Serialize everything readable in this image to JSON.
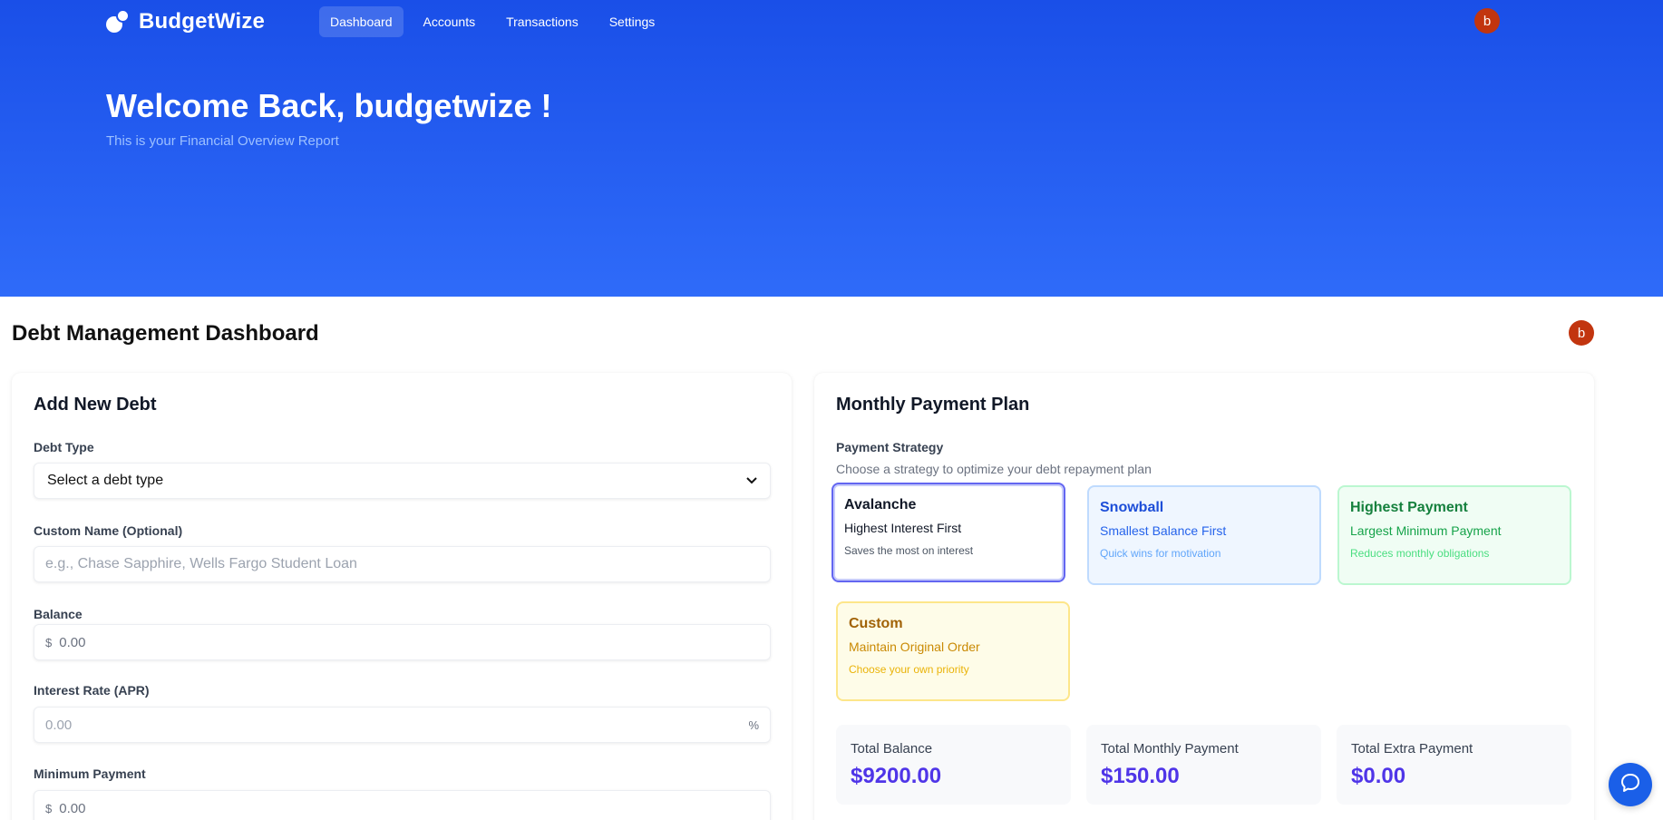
{
  "app": {
    "name": "BudgetWize",
    "logo_icon": "budgetwize-logo-icon"
  },
  "nav": {
    "items": [
      {
        "label": "Dashboard",
        "active": true
      },
      {
        "label": "Accounts",
        "active": false
      },
      {
        "label": "Transactions",
        "active": false
      },
      {
        "label": "Settings",
        "active": false
      }
    ]
  },
  "user": {
    "avatar_initial": "b",
    "avatar_color": "#c2350f"
  },
  "hero": {
    "welcome": "Welcome Back, budgetwize !",
    "subtitle": "This is your Financial Overview Report"
  },
  "page": {
    "title": "Debt Management Dashboard"
  },
  "add_debt": {
    "title": "Add New Debt",
    "debt_type_label": "Debt Type",
    "debt_type_value": "Select a debt type",
    "custom_name_label": "Custom Name (Optional)",
    "custom_name_placeholder": "e.g., Chase Sapphire, Wells Fargo Student Loan",
    "balance_label": "Balance",
    "balance_prefix": "$",
    "balance_placeholder": "0.00",
    "interest_label": "Interest Rate (APR)",
    "interest_placeholder": "0.00",
    "interest_suffix": "%",
    "min_payment_label": "Minimum Payment",
    "min_payment_prefix": "$",
    "min_payment_placeholder": "0.00"
  },
  "payment_plan": {
    "title": "Monthly Payment Plan",
    "strategy_label": "Payment Strategy",
    "strategy_sub": "Choose a strategy to optimize your debt repayment plan",
    "strategies": [
      {
        "name": "Avalanche",
        "title": "Highest Interest First",
        "desc": "Saves the most on interest",
        "selected": true
      },
      {
        "name": "Snowball",
        "title": "Smallest Balance First",
        "desc": "Quick wins for motivation",
        "selected": false
      },
      {
        "name": "Highest Payment",
        "title": "Largest Minimum Payment",
        "desc": "Reduces monthly obligations",
        "selected": false
      },
      {
        "name": "Custom",
        "title": "Maintain Original Order",
        "desc": "Choose your own priority",
        "selected": false
      }
    ],
    "stats": [
      {
        "label": "Total Balance",
        "value": "$9200.00"
      },
      {
        "label": "Total Monthly Payment",
        "value": "$150.00"
      },
      {
        "label": "Total Extra Payment",
        "value": "$0.00"
      }
    ]
  },
  "colors": {
    "hero_top": "#1a4fe8",
    "hero_bottom": "#2f6bf9",
    "accent": "#4f35e8",
    "selected_border": "#6366f1"
  },
  "chat": {
    "icon": "chat-bubble-icon"
  }
}
